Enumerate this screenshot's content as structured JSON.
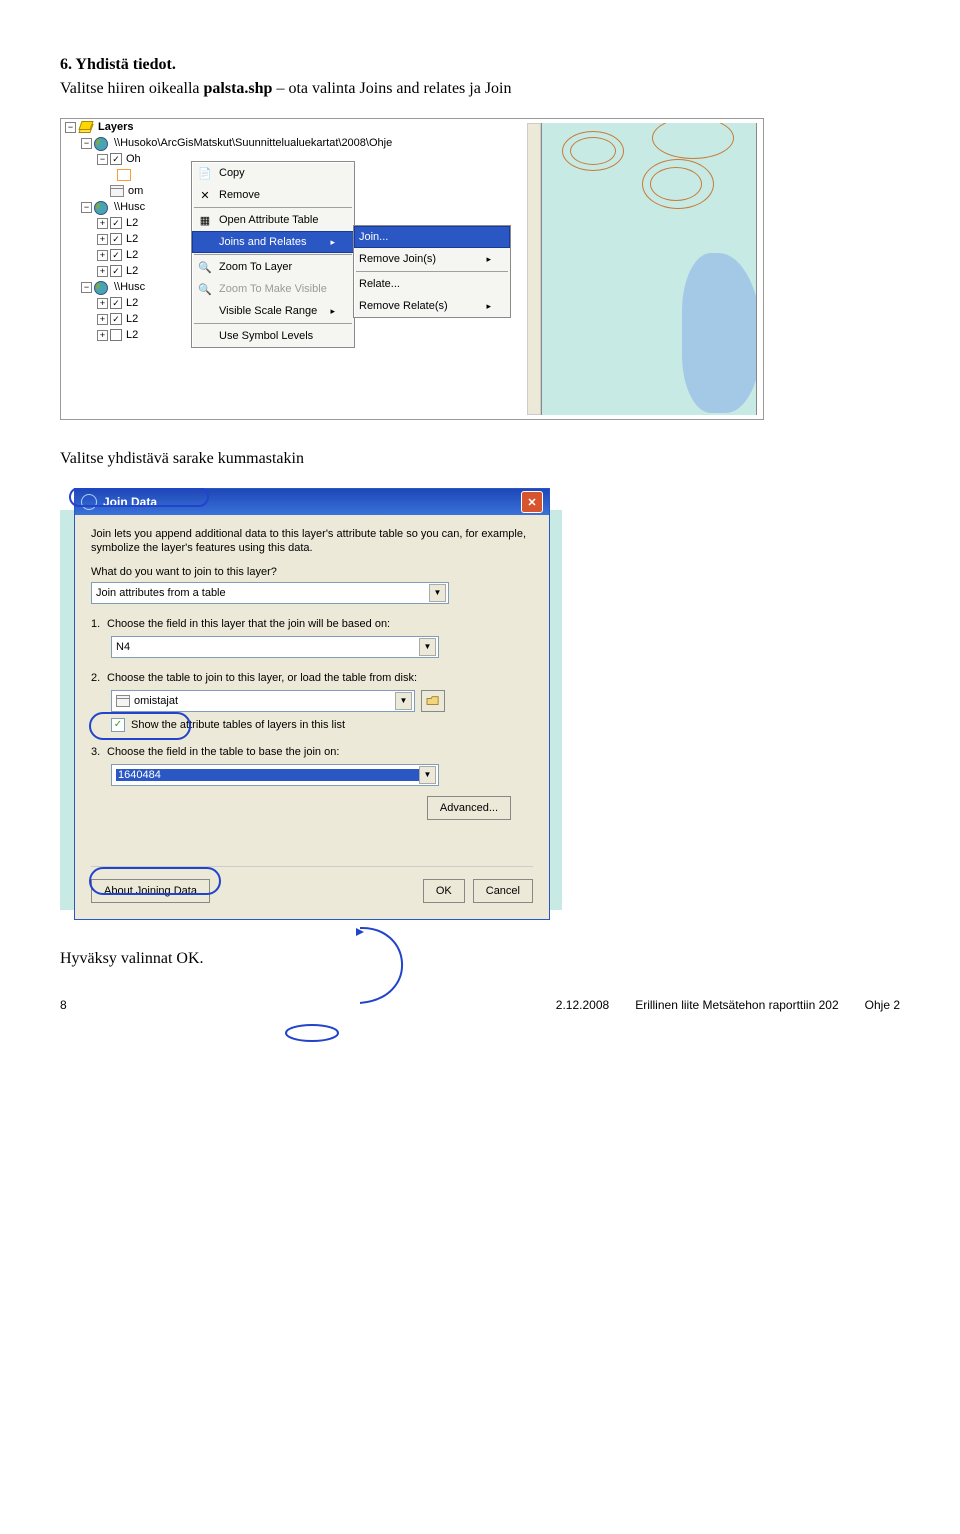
{
  "heading": "6. Yhdistä tiedot.",
  "intro": {
    "part1": "Valitse hiiren oikealla ",
    "file": "palsta.shp",
    "part2": " – ota valinta Joins and relates ja Join"
  },
  "toc": {
    "layers": "Layers",
    "group1_label": "\\\\Husoko\\ArcGisMatskut\\Suunnittelualuekartat\\2008\\Ohje",
    "layer_oh": "Oh",
    "layer_om": "om",
    "group2_prefix": "\\\\Husc",
    "l2": "L2",
    "group3_prefix": "\\\\Husc"
  },
  "ctx": {
    "copy": "Copy",
    "remove": "Remove",
    "open_attr": "Open Attribute Table",
    "joins": "Joins and Relates",
    "zoom_layer": "Zoom To Layer",
    "zoom_visible": "Zoom To Make Visible",
    "scale_range": "Visible Scale Range",
    "symbol_levels": "Use Symbol Levels"
  },
  "submenu": {
    "join": "Join...",
    "remove_join": "Remove Join(s)",
    "relate": "Relate...",
    "remove_relate": "Remove Relate(s)"
  },
  "mid_text": "Valitse yhdistävä sarake kummastakin",
  "join": {
    "title": "Join Data",
    "explain": "Join lets you append additional data to this layer's attribute table so you can, for example, symbolize the layer's features using this data.",
    "q": "What do you want to join to this layer?",
    "combo1": "Join attributes from a table",
    "step1": "Choose the field in this layer that the join will be based on:",
    "field1": "N4",
    "step2": "Choose the table to join to this layer, or load the table from disk:",
    "table": "omistajat",
    "show_attr": "Show the attribute tables of layers in this list",
    "step3": "Choose the field in the table to base the join on:",
    "field3": "1640484",
    "adv": "Advanced...",
    "about": "About Joining Data",
    "ok": "OK",
    "cancel": "Cancel"
  },
  "approve": "Hyväksy valinnat OK.",
  "footer": {
    "page": "8",
    "date": "2.12.2008",
    "source": "Erillinen liite Metsätehon raporttiin 202",
    "guide": "Ohje 2"
  }
}
